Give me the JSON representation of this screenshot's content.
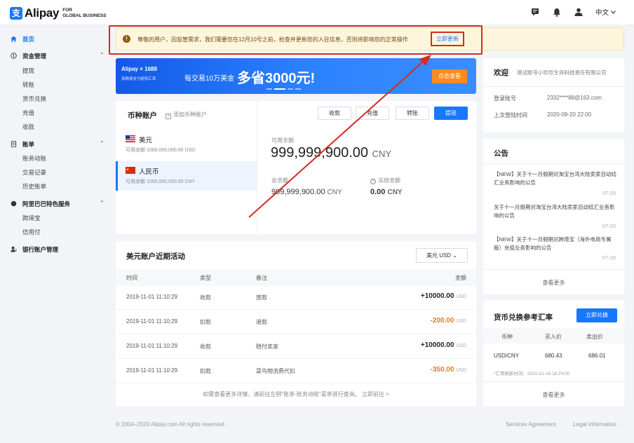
{
  "header": {
    "logo_mark": "支",
    "logo_text": "Alipay",
    "logo_sub1": "FOR",
    "logo_sub2": "GLOBAL BUSINESS",
    "language": "中文",
    "icons": [
      "message-icon",
      "bell-icon",
      "user-icon"
    ]
  },
  "sidebar": {
    "home": "首页",
    "fund_mgmt": "资金管理",
    "fund_items": [
      "提现",
      "转账",
      "货币兑换",
      "充值",
      "收款"
    ],
    "bill": "账单",
    "bill_items": [
      "账务动账",
      "交易记录",
      "历史账单"
    ],
    "alibaba": "阿里巴巴特色服务",
    "alibaba_items": [
      "跨境宝",
      "信用付"
    ],
    "bank": "银行账户管理"
  },
  "notice": {
    "text": "尊敬的用户，因监管需求，我们需要您在12月10号之前，检查并更新您的入驻信息，否则将影响您的正常操作",
    "button": "立即更新"
  },
  "banner": {
    "logo": "Alipay × 1688",
    "logo_sub": "亮跨境支付超低汇率",
    "text1": "每交易10万美金",
    "text2": "多省3000元!",
    "button": "点击查看"
  },
  "accounts": {
    "title": "币种账户",
    "add": "添加币种账户",
    "list": [
      {
        "name": "美元",
        "balance": "可用余额 1000,000,000.00 USD"
      },
      {
        "name": "人民币",
        "balance": "可用余额 1000,000,000.00 CNY"
      }
    ],
    "actions": [
      "收款",
      "充值",
      "转账",
      "提现"
    ],
    "available_label": "可用余额",
    "available_value": "999,999,900.00",
    "available_unit": "CNY",
    "total_label": "总余额",
    "total_value": "999,999,900.00",
    "total_unit": "CNY",
    "frozen_label": "冻结金额",
    "frozen_value": "0.00",
    "frozen_unit": "CNY"
  },
  "activity": {
    "title": "美元账户近期活动",
    "currency_select": "美元 USD",
    "columns": [
      "时间",
      "类型",
      "备注",
      "金额"
    ],
    "rows": [
      {
        "time": "2019-11-01 11:10:29",
        "type": "收款",
        "note": "放款",
        "amount": "+10000.00",
        "unit": "USD"
      },
      {
        "time": "2019-11-01 11:10:29",
        "type": "扣款",
        "note": "退款",
        "amount": "-200.00",
        "unit": "USD"
      },
      {
        "time": "2019-11-01 11:10:29",
        "type": "收款",
        "note": "赔付卖家",
        "amount": "+10000.00",
        "unit": "USD"
      },
      {
        "time": "2019-11-01 11:10:29",
        "type": "扣款",
        "note": "菜鸟物流费代扣",
        "amount": "-350.00",
        "unit": "USD"
      }
    ],
    "footer": "如需查看更多详情，请前往左侧\"账单-账务动账\"菜单进行查询。 立即前往 >"
  },
  "welcome": {
    "title": "欢迎",
    "company": "测试账号小珍珍生命科技责任有限公司",
    "login_label": "登录账号",
    "login_value": "2332****88@163.com",
    "last_label": "上次登陆时间",
    "last_value": "2020-09-20 22:00"
  },
  "announcements": {
    "title": "公告",
    "items": [
      {
        "text": "【NEW】关于十一月假期对淘宝台湾大陆卖家自动结汇业务影响的公告",
        "date": "07-20"
      },
      {
        "text": "关于十一月假期对淘宝台湾大陆卖家自动结汇业务影响的公告",
        "date": "07-20"
      },
      {
        "text": "【NEW】关于十一月假期对跨境宝（海外电商专属版）充值业务影响的公告",
        "date": "07-20"
      }
    ],
    "more": "查看更多"
  },
  "rates": {
    "title": "货币兑换参考汇率",
    "button": "立即兑换",
    "columns": [
      "币种",
      "买入价",
      "卖出价"
    ],
    "row": {
      "pair": "USD/CNY",
      "buy": "680.43",
      "sell": "686.01"
    },
    "refresh": "*汇率刷新时间：2021-01-16 16:24:00",
    "more": "查看更多"
  },
  "footer": {
    "copyright": "© 2004–2020 Alipay.com All rights reserved.",
    "agreement": "Services Agreement",
    "legal": "Legal Information"
  },
  "colors": {
    "accent": "#1677ff",
    "annotation_red": "#d62a24",
    "negative": "#f5761b",
    "notice_bg": "#fdf6dc"
  }
}
